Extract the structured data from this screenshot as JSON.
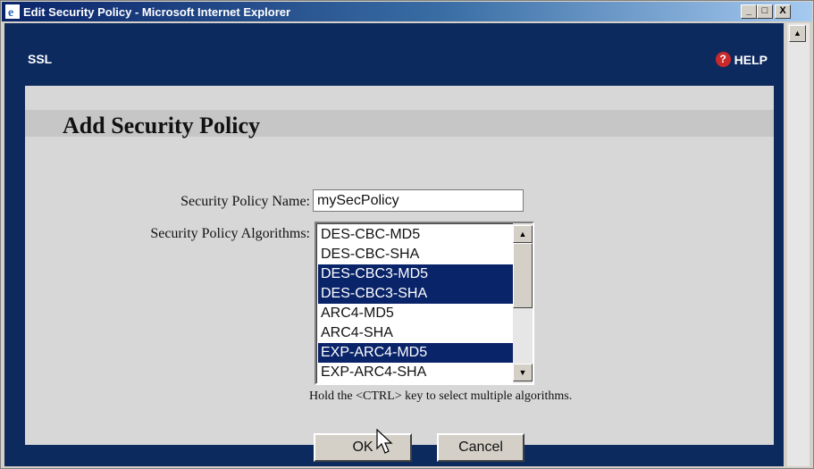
{
  "window": {
    "title": "Edit Security Policy - Microsoft Internet Explorer",
    "minimize_label": "_",
    "maximize_label": "□",
    "close_label": "X"
  },
  "header": {
    "brand": "SSL",
    "help_icon_glyph": "?",
    "help_label": "HELP"
  },
  "page": {
    "heading": "Add Security Policy"
  },
  "form": {
    "name_label": "Security Policy Name:",
    "name_value": "mySecPolicy",
    "algorithms_label": "Security Policy Algorithms:",
    "algorithms": [
      {
        "label": "DES-CBC-MD5",
        "selected": false
      },
      {
        "label": "DES-CBC-SHA",
        "selected": false
      },
      {
        "label": "DES-CBC3-MD5",
        "selected": true
      },
      {
        "label": "DES-CBC3-SHA",
        "selected": true
      },
      {
        "label": "ARC4-MD5",
        "selected": false
      },
      {
        "label": "ARC4-SHA",
        "selected": false
      },
      {
        "label": "EXP-ARC4-MD5",
        "selected": true
      },
      {
        "label": "EXP-ARC4-SHA",
        "selected": false
      }
    ],
    "hint": "Hold the <CTRL> key to select multiple algorithms.",
    "ok_label": "OK",
    "cancel_label": "Cancel"
  },
  "icons": {
    "title": "ie-logo-icon",
    "help": "help-icon",
    "scroll_up": "scroll-up-arrow-icon",
    "scroll_down": "scroll-down-arrow-icon",
    "cursor": "mouse-pointer-icon"
  },
  "colors": {
    "page_background": "#0d2a5f",
    "panel_background": "#d7d7d7",
    "selection": "#0a246a",
    "help_icon": "#c9292b"
  }
}
